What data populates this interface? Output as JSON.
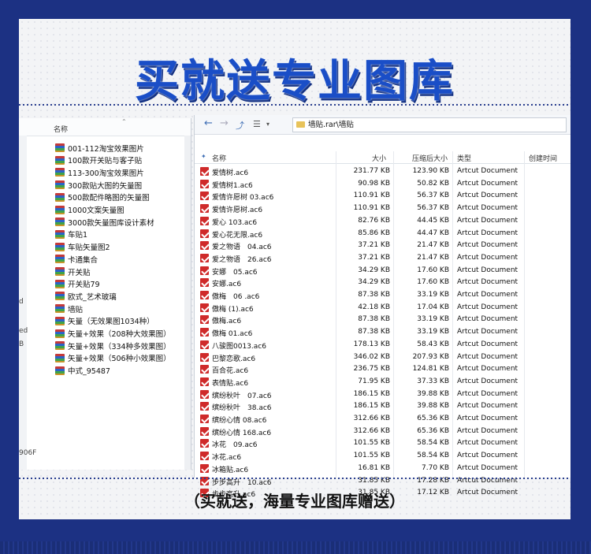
{
  "headline": "买就送专业图库",
  "caption": "（买就送，海量专业图库赠送）",
  "left_window": {
    "column_label": "名称",
    "strip_chars": [
      "d",
      "ed",
      "B",
      "906F"
    ],
    "items": [
      "001-112淘宝效果图片",
      "100款开关贴与客子贴",
      "113-300淘宝效果图片",
      "300款贴大图的矢量图",
      "500款配件略图的矢量图",
      "1000文案矢量图",
      "3000款矢量图库设计素材",
      "车贴1",
      "车贴矢量图2",
      "卡通集合",
      "开关贴",
      "开关贴79",
      "欧式_艺术玻璃",
      "墙贴",
      "矢量（无效果图1034种）",
      "矢量+效果（208种大效果图）",
      "矢量+效果（334种多效果图）",
      "矢量+效果（506种小效果图）",
      "中式_95487"
    ]
  },
  "right_window": {
    "address": "墙贴.rar\\墙贴",
    "columns": [
      "名称",
      "大小",
      "压缩后大小",
      "类型",
      "创建时间"
    ],
    "rows": [
      [
        "爱情树.ac6",
        "231.77 KB",
        "123.90 KB",
        "Artcut Document"
      ],
      [
        "爱情树1.ac6",
        "90.98 KB",
        "50.82 KB",
        "Artcut Document"
      ],
      [
        "爱情许愿树 03.ac6",
        "110.91 KB",
        "56.37 KB",
        "Artcut Document"
      ],
      [
        "爱情许愿树.ac6",
        "110.91 KB",
        "56.37 KB",
        "Artcut Document"
      ],
      [
        "爱心 103.ac6",
        "82.76 KB",
        "44.45 KB",
        "Artcut Document"
      ],
      [
        "爱心花无限.ac6",
        "85.86 KB",
        "44.47 KB",
        "Artcut Document"
      ],
      [
        "爱之物语　04.ac6",
        "37.21 KB",
        "21.47 KB",
        "Artcut Document"
      ],
      [
        "爱之物语　26.ac6",
        "37.21 KB",
        "21.47 KB",
        "Artcut Document"
      ],
      [
        "安娜　05.ac6",
        "34.29 KB",
        "17.60 KB",
        "Artcut Document"
      ],
      [
        "安娜.ac6",
        "34.29 KB",
        "17.60 KB",
        "Artcut Document"
      ],
      [
        "傲梅　06 .ac6",
        "87.38 KB",
        "33.19 KB",
        "Artcut Document"
      ],
      [
        "傲梅 (1).ac6",
        "42.18 KB",
        "17.04 KB",
        "Artcut Document"
      ],
      [
        "傲梅.ac6",
        "87.38 KB",
        "33.19 KB",
        "Artcut Document"
      ],
      [
        "傲梅 01.ac6",
        "87.38 KB",
        "33.19 KB",
        "Artcut Document"
      ],
      [
        "八骏图0013.ac6",
        "178.13 KB",
        "58.43 KB",
        "Artcut Document"
      ],
      [
        "巴黎恋歌.ac6",
        "346.02 KB",
        "207.93 KB",
        "Artcut Document"
      ],
      [
        "百合花.ac6",
        "236.75 KB",
        "124.81 KB",
        "Artcut Document"
      ],
      [
        "表情贴.ac6",
        "71.95 KB",
        "37.33 KB",
        "Artcut Document"
      ],
      [
        "缤纷秋叶　07.ac6",
        "186.15 KB",
        "39.88 KB",
        "Artcut Document"
      ],
      [
        "缤纷秋叶　38.ac6",
        "186.15 KB",
        "39.88 KB",
        "Artcut Document"
      ],
      [
        "缤纷心情 08.ac6",
        "312.66 KB",
        "65.36 KB",
        "Artcut Document"
      ],
      [
        "缤纷心情 168.ac6",
        "312.66 KB",
        "65.36 KB",
        "Artcut Document"
      ],
      [
        "冰花　09.ac6",
        "101.55 KB",
        "58.54 KB",
        "Artcut Document"
      ],
      [
        "冰花.ac6",
        "101.55 KB",
        "58.54 KB",
        "Artcut Document"
      ],
      [
        "冰箱贴.ac6",
        "16.81 KB",
        "7.70 KB",
        "Artcut Document"
      ],
      [
        "步步高升　10.ac6",
        "31.85 KB",
        "17.28 KB",
        "Artcut Document"
      ],
      [
        "步步高升.ac6",
        "31.85 KB",
        "17.12 KB",
        "Artcut Document"
      ]
    ]
  }
}
